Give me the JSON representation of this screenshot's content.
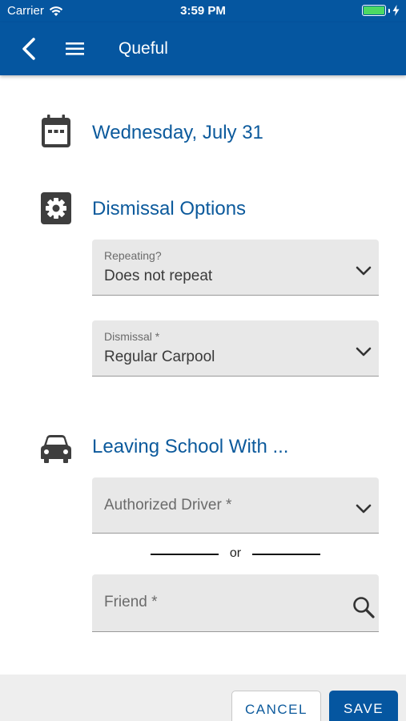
{
  "status_bar": {
    "carrier": "Carrier",
    "time": "3:59 PM",
    "battery_level": 1.0,
    "battery_color": "#4cd964"
  },
  "nav": {
    "title": "Queful",
    "back_icon": "chevron-left-icon",
    "menu_icon": "hamburger-icon",
    "color": "#0556a0"
  },
  "date_section": {
    "icon": "calendar-icon",
    "title": "Wednesday, July 31"
  },
  "dismissal_section": {
    "icon": "gear-icon",
    "title": "Dismissal Options",
    "repeating": {
      "label": "Repeating?",
      "value": "Does not repeat"
    },
    "dismissal": {
      "label": "Dismissal *",
      "value": "Regular Carpool"
    }
  },
  "leaving_section": {
    "icon": "car-icon",
    "title": "Leaving School With ...",
    "authorized_driver": {
      "placeholder": "Authorized Driver *"
    },
    "separator": "or",
    "friend": {
      "placeholder": "Friend *"
    }
  },
  "footer": {
    "cancel_label": "CANCEL",
    "save_label": "SAVE"
  },
  "colors": {
    "accent": "#0556a0",
    "title_text": "#0c5a9c",
    "field_bg": "#e8e8e8"
  }
}
